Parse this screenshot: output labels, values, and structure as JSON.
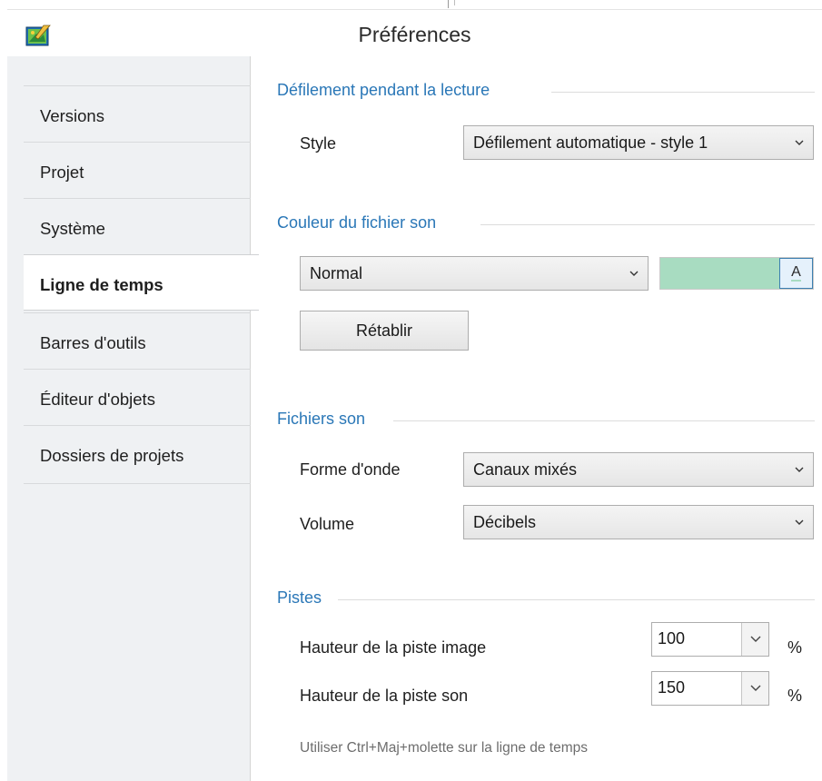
{
  "window": {
    "title": "Préférences",
    "app_icon": "paint-app-icon"
  },
  "sidebar": {
    "items": [
      {
        "label": "Versions",
        "selected": false
      },
      {
        "label": "Projet",
        "selected": false
      },
      {
        "label": "Système",
        "selected": false
      },
      {
        "label": "Ligne de temps",
        "selected": true
      },
      {
        "label": "Barres d'outils",
        "selected": false
      },
      {
        "label": "Éditeur d'objets",
        "selected": false
      },
      {
        "label": "Dossiers de projets",
        "selected": false
      }
    ]
  },
  "sections": {
    "scroll": {
      "title": "Défilement pendant la lecture",
      "style_label": "Style",
      "style_value": "Défilement automatique - style 1"
    },
    "sound_color": {
      "title": "Couleur du fichier son",
      "mode_value": "Normal",
      "swatch_color": "#a8dcc1",
      "color_button_label": "A",
      "reset_label": "Rétablir"
    },
    "sound_files": {
      "title": "Fichiers son",
      "waveform_label": "Forme d'onde",
      "waveform_value": "Canaux mixés",
      "volume_label": "Volume",
      "volume_value": "Décibels"
    },
    "tracks": {
      "title": "Pistes",
      "image_track_label": "Hauteur de la piste image",
      "image_track_value": "100",
      "image_track_unit": "%",
      "sound_track_label": "Hauteur de la piste son",
      "sound_track_value": "150",
      "sound_track_unit": "%",
      "hint": "Utiliser Ctrl+Maj+molette sur la ligne de temps"
    }
  },
  "colors": {
    "section_title": "#2a77b7",
    "sidebar_bg": "#eff1f3",
    "accent_swatch": "#a8dcc1"
  }
}
